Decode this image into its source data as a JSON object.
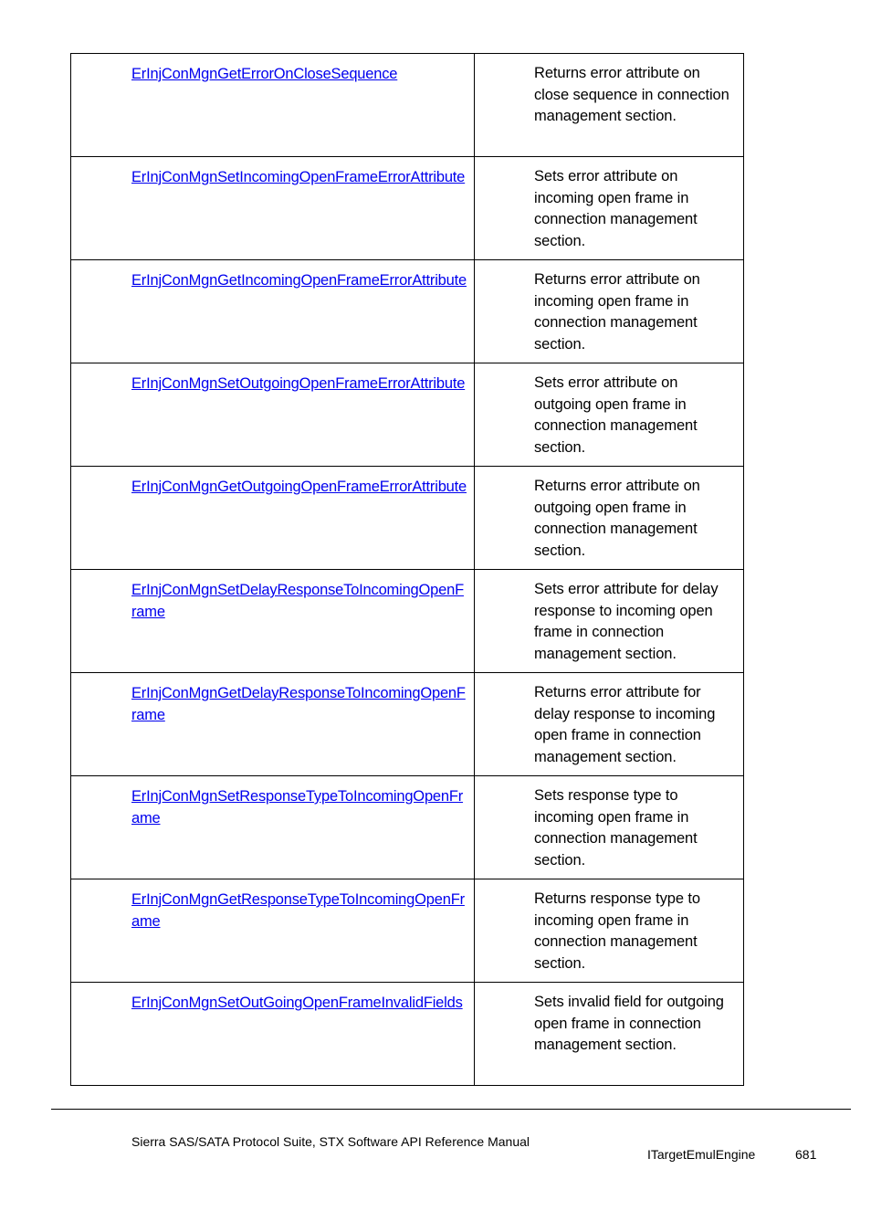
{
  "rows": [
    {
      "link": "ErInjConMgnGetErrorOnCloseSequence",
      "desc": "Returns error attribute on close sequence in connection management section."
    },
    {
      "link": "ErInjConMgnSetIncomingOpenFrameErrorAttribute",
      "desc": "Sets error attribute on incoming open frame in connection management section."
    },
    {
      "link": "ErInjConMgnGetIncomingOpenFrameErrorAttribute",
      "desc": "Returns error attribute on incoming open frame in connection management section."
    },
    {
      "link": "ErInjConMgnSetOutgoingOpenFrameErrorAttribute",
      "desc": "Sets error attribute on outgoing open frame in connection management section."
    },
    {
      "link": "ErInjConMgnGetOutgoingOpenFrameErrorAttribute",
      "desc": "Returns error attribute on outgoing open frame in connection management section."
    },
    {
      "link": "ErInjConMgnSetDelayResponseToIncomingOpenFrame",
      "desc": "Sets error attribute for delay response to incoming open frame in connection management section."
    },
    {
      "link": "ErInjConMgnGetDelayResponseToIncomingOpenFrame",
      "desc": "Returns error attribute for delay response to incoming open frame in connection management section."
    },
    {
      "link": "ErInjConMgnSetResponseTypeToIncomingOpenFrame",
      "desc": "Sets response type to incoming open frame in connection management section."
    },
    {
      "link": "ErInjConMgnGetResponseTypeToIncomingOpenFrame",
      "desc": "Returns response type to incoming open frame in connection management section."
    },
    {
      "link": "ErInjConMgnSetOutGoingOpenFrameInvalidFields",
      "desc": "Sets invalid field for outgoing open frame in connection management section."
    }
  ],
  "footer": {
    "manual_title": "Sierra SAS/SATA Protocol Suite, STX Software API Reference Manual",
    "section": "ITargetEmulEngine",
    "page_number": "681"
  }
}
